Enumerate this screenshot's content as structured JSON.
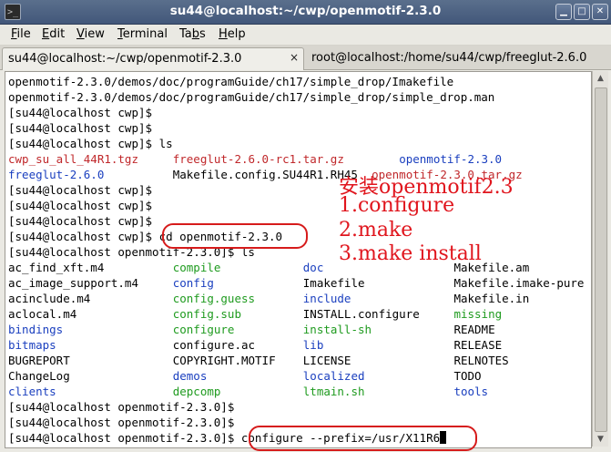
{
  "window": {
    "title": "su44@localhost:~/cwp/openmotif-2.3.0",
    "app_icon": "terminal-icon",
    "buttons": [
      "minimize-icon",
      "maximize-icon",
      "close-icon"
    ]
  },
  "menu": [
    {
      "label": "File",
      "u": "F",
      "rest": "ile"
    },
    {
      "label": "Edit",
      "u": "E",
      "rest": "dit"
    },
    {
      "label": "View",
      "u": "V",
      "rest": "iew"
    },
    {
      "label": "Terminal",
      "u": "T",
      "rest": "erminal"
    },
    {
      "label": "Tabs",
      "pre": "Ta",
      "u": "b",
      "rest": "s"
    },
    {
      "label": "Help",
      "u": "H",
      "rest": "elp"
    }
  ],
  "tabs": [
    {
      "label": "su44@localhost:~/cwp/openmotif-2.3.0",
      "close": "×",
      "active": true
    },
    {
      "label": "root@localhost:/home/su44/cwp/freeglut-2.6.0",
      "active": false
    }
  ],
  "terminal": {
    "lines": [
      [
        {
          "t": "openmotif-2.3.0/demos/doc/programGuide/ch17/simple_drop/Imakefile",
          "c": "black"
        }
      ],
      [
        {
          "t": "openmotif-2.3.0/demos/doc/programGuide/ch17/simple_drop/simple_drop.man",
          "c": "black"
        }
      ],
      [
        {
          "t": "[su44@localhost cwp]$",
          "c": "black"
        }
      ],
      [
        {
          "t": "[su44@localhost cwp]$",
          "c": "black"
        }
      ],
      [
        {
          "t": "[su44@localhost cwp]$ ls",
          "c": "black"
        }
      ],
      [
        {
          "t": "cwp_su_all_44R1.tgz",
          "c": "red"
        },
        {
          "t": "freeglut-2.6.0-rc1.tar.gz",
          "c": "red",
          "col": 24
        },
        {
          "t": "openmotif-2.3.0",
          "c": "blue",
          "col": 57
        }
      ],
      [
        {
          "t": "freeglut-2.6.0",
          "c": "blue"
        },
        {
          "t": "Makefile.config.SU44R1.RH45",
          "c": "black",
          "col": 24
        },
        {
          "t": "openmotif-2.3.0.tar.gz",
          "c": "red",
          "col": 53
        }
      ],
      [
        {
          "t": "[su44@localhost cwp]$",
          "c": "black"
        }
      ],
      [
        {
          "t": "[su44@localhost cwp]$",
          "c": "black"
        }
      ],
      [
        {
          "t": "[su44@localhost cwp]$",
          "c": "black"
        }
      ],
      [
        {
          "t": "[su44@localhost cwp]$ cd openmotif-2.3.0",
          "c": "black"
        }
      ],
      [
        {
          "t": "[su44@localhost openmotif-2.3.0]$ ls",
          "c": "black"
        }
      ],
      [
        {
          "t": "ac_find_xft.m4",
          "c": "black"
        },
        {
          "t": "compile",
          "c": "green",
          "col": 24
        },
        {
          "t": "doc",
          "c": "blue",
          "col": 43
        },
        {
          "t": "Makefile.am",
          "c": "black",
          "col": 65
        }
      ],
      [
        {
          "t": "ac_image_support.m4",
          "c": "black"
        },
        {
          "t": "config",
          "c": "blue",
          "col": 24
        },
        {
          "t": "Imakefile",
          "c": "black",
          "col": 43
        },
        {
          "t": "Makefile.imake-pure",
          "c": "black",
          "col": 65
        }
      ],
      [
        {
          "t": "acinclude.m4",
          "c": "black"
        },
        {
          "t": "config.guess",
          "c": "green",
          "col": 24
        },
        {
          "t": "include",
          "c": "blue",
          "col": 43
        },
        {
          "t": "Makefile.in",
          "c": "black",
          "col": 65
        }
      ],
      [
        {
          "t": "aclocal.m4",
          "c": "black"
        },
        {
          "t": "config.sub",
          "c": "green",
          "col": 24
        },
        {
          "t": "INSTALL.configure",
          "c": "black",
          "col": 43
        },
        {
          "t": "missing",
          "c": "green",
          "col": 65
        }
      ],
      [
        {
          "t": "bindings",
          "c": "blue"
        },
        {
          "t": "configure",
          "c": "green",
          "col": 24
        },
        {
          "t": "install-sh",
          "c": "green",
          "col": 43
        },
        {
          "t": "README",
          "c": "black",
          "col": 65
        }
      ],
      [
        {
          "t": "bitmaps",
          "c": "blue"
        },
        {
          "t": "configure.ac",
          "c": "black",
          "col": 24
        },
        {
          "t": "lib",
          "c": "blue",
          "col": 43
        },
        {
          "t": "RELEASE",
          "c": "black",
          "col": 65
        }
      ],
      [
        {
          "t": "BUGREPORT",
          "c": "black"
        },
        {
          "t": "COPYRIGHT.MOTIF",
          "c": "black",
          "col": 24
        },
        {
          "t": "LICENSE",
          "c": "black",
          "col": 43
        },
        {
          "t": "RELNOTES",
          "c": "black",
          "col": 65
        }
      ],
      [
        {
          "t": "ChangeLog",
          "c": "black"
        },
        {
          "t": "demos",
          "c": "blue",
          "col": 24
        },
        {
          "t": "localized",
          "c": "blue",
          "col": 43
        },
        {
          "t": "TODO",
          "c": "black",
          "col": 65
        }
      ],
      [
        {
          "t": "clients",
          "c": "blue"
        },
        {
          "t": "depcomp",
          "c": "green",
          "col": 24
        },
        {
          "t": "ltmain.sh",
          "c": "green",
          "col": 43
        },
        {
          "t": "tools",
          "c": "blue",
          "col": 65
        }
      ],
      [
        {
          "t": "[su44@localhost openmotif-2.3.0]$",
          "c": "black"
        }
      ],
      [
        {
          "t": "[su44@localhost openmotif-2.3.0]$",
          "c": "black"
        }
      ],
      [
        {
          "t": "[su44@localhost openmotif-2.3.0]$ configure --prefix=/usr/X11R6",
          "c": "black"
        }
      ]
    ]
  },
  "annotation": {
    "line1": "安装openmotif2.3",
    "line2": "1.configure",
    "line3": "2.make",
    "line4": "3.make install",
    "color": "#e0151d"
  },
  "scrollbar": {
    "up": "▲",
    "down": "▼"
  }
}
